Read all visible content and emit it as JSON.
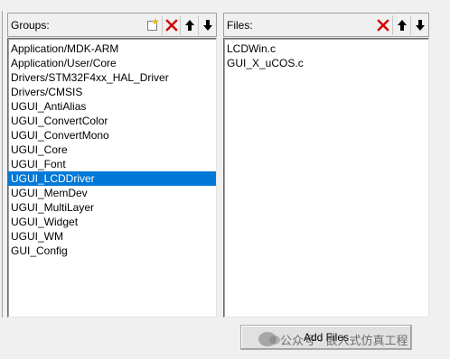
{
  "groups": {
    "caption": "Groups:",
    "items": [
      "Application/MDK-ARM",
      "Application/User/Core",
      "Drivers/STM32F4xx_HAL_Driver",
      "Drivers/CMSIS",
      "UGUI_AntiAlias",
      "UGUI_ConvertColor",
      "UGUI_ConvertMono",
      "UGUI_Core",
      "UGUI_Font",
      "UGUI_LCDDriver",
      "UGUI_MemDev",
      "UGUI_MultiLayer",
      "UGUI_Widget",
      "UGUI_WM",
      "GUI_Config"
    ],
    "selected": "UGUI_LCDDriver",
    "toolbar": [
      "new-group-icon",
      "delete-icon",
      "move-up-icon",
      "move-down-icon"
    ]
  },
  "files": {
    "caption": "Files:",
    "items": [
      "LCDWin.c",
      "GUI_X_uCOS.c"
    ],
    "toolbar": [
      "delete-icon",
      "move-up-icon",
      "move-down-icon"
    ]
  },
  "buttons": {
    "add_files": "Add Files"
  },
  "watermark": {
    "text": "公众号 · 嵌入式仿真工程"
  },
  "colors": {
    "selection": "#0078d7",
    "delete_red": "#d40000",
    "window_bg": "#f0f0f0"
  }
}
